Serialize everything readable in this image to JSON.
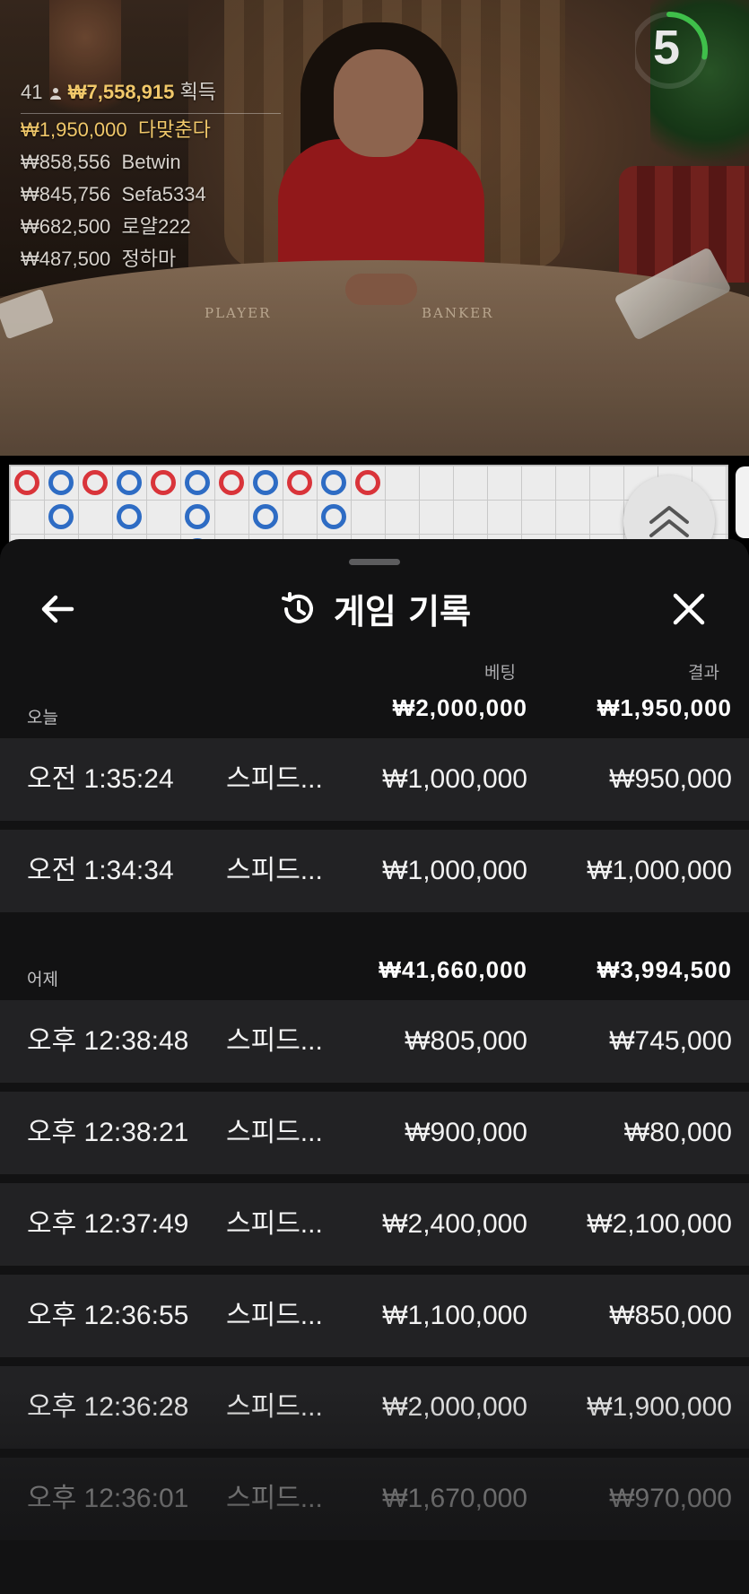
{
  "leaderboard": {
    "player_count": "41",
    "total_won": "₩7,558,915",
    "total_won_label": "획득",
    "entries": [
      {
        "amount": "₩1,950,000",
        "name": "다맞춘다"
      },
      {
        "amount": "₩858,556",
        "name": "Betwin"
      },
      {
        "amount": "₩845,756",
        "name": "Sefa5334"
      },
      {
        "amount": "₩682,500",
        "name": "로얄222"
      },
      {
        "amount": "₩487,500",
        "name": "정하마"
      }
    ]
  },
  "timer": {
    "seconds": "5",
    "remaining_fraction": 0.28,
    "color": "#3fbf4a"
  },
  "table": {
    "player_label": "PLAYER",
    "banker_label": "BANKER"
  },
  "roadmap": {
    "columns": [
      [
        "r"
      ],
      [
        "b",
        "b"
      ],
      [
        "r"
      ],
      [
        "b",
        "b"
      ],
      [
        "r"
      ],
      [
        "b",
        "b",
        "b"
      ],
      [
        "r"
      ],
      [
        "b",
        "b"
      ],
      [
        "r"
      ],
      [
        "b",
        "b"
      ],
      [
        "r"
      ]
    ],
    "colors": {
      "banker": "#d9343a",
      "player": "#2e6cc4"
    }
  },
  "sheet": {
    "title": "게임 기록",
    "icons": {
      "back": "arrow-left-icon",
      "history": "history-icon",
      "close": "close-icon"
    },
    "columns": {
      "bet": "베팅",
      "result": "결과"
    },
    "days": [
      {
        "label": "오늘",
        "total_bet": "₩2,000,000",
        "total_result": "₩1,950,000",
        "rows": [
          {
            "time": "오전 1:35:24",
            "game": "스피드...",
            "bet": "₩1,000,000",
            "result": "₩950,000"
          },
          {
            "time": "오전 1:34:34",
            "game": "스피드...",
            "bet": "₩1,000,000",
            "result": "₩1,000,000"
          }
        ]
      },
      {
        "label": "어제",
        "total_bet": "₩41,660,000",
        "total_result": "₩3,994,500",
        "rows": [
          {
            "time": "오후 12:38:48",
            "game": "스피드...",
            "bet": "₩805,000",
            "result": "₩745,000"
          },
          {
            "time": "오후 12:38:21",
            "game": "스피드...",
            "bet": "₩900,000",
            "result": "₩80,000"
          },
          {
            "time": "오후 12:37:49",
            "game": "스피드...",
            "bet": "₩2,400,000",
            "result": "₩2,100,000"
          },
          {
            "time": "오후 12:36:55",
            "game": "스피드...",
            "bet": "₩1,100,000",
            "result": "₩850,000"
          },
          {
            "time": "오후 12:36:28",
            "game": "스피드...",
            "bet": "₩2,000,000",
            "result": "₩1,900,000"
          },
          {
            "time": "오후 12:36:01",
            "game": "스피드...",
            "bet": "₩1,670,000",
            "result": "₩970,000"
          }
        ]
      }
    ]
  }
}
